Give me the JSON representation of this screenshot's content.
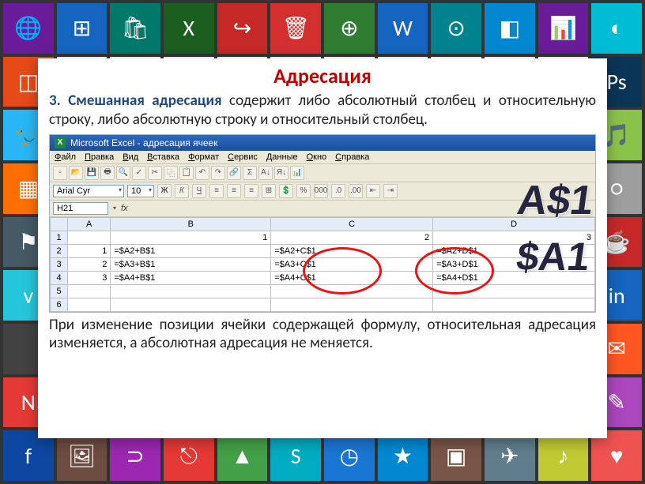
{
  "slide": {
    "title": "Адресация",
    "intro_num": "3.",
    "intro_bold": "Смешанная адресация",
    "intro_rest": " содержит либо абсолютный столбец и относительную строку, либо абсолютную строку и относительный столбец.",
    "outro": "При изменение позиции ячейки содержащей формулу, относительная адресация изменяется, а абсолютная адресация не меняется.",
    "ref1": "A$1",
    "ref2": "$A1"
  },
  "excel": {
    "title": "Microsoft Excel - адресация ячеек",
    "menu": [
      "Файл",
      "Правка",
      "Вид",
      "Вставка",
      "Формат",
      "Сервис",
      "Данные",
      "Окно",
      "Справка"
    ],
    "font": "Arial Cyr",
    "size": "10",
    "fmtbtns": [
      "Ж",
      "К",
      "Ч"
    ],
    "namebox": "H21",
    "fx": "fx",
    "cols": [
      "A",
      "B",
      "C",
      "D"
    ],
    "rows": [
      {
        "n": "1",
        "A": "",
        "B": "1",
        "C": "2",
        "D": "3"
      },
      {
        "n": "2",
        "A": "1",
        "B": "=$A2+B$1",
        "C": "=$A2+C$1",
        "D": "=$A2+D$1"
      },
      {
        "n": "3",
        "A": "2",
        "B": "=$A3+B$1",
        "C": "=$A3+C$1",
        "D": "=$A3+D$1"
      },
      {
        "n": "4",
        "A": "3",
        "B": "=$A4+B$1",
        "C": "=$A4+C$1",
        "D": "=$A4+D$1"
      },
      {
        "n": "5",
        "A": "",
        "B": "",
        "C": "",
        "D": ""
      },
      {
        "n": "6",
        "A": "",
        "B": "",
        "C": "",
        "D": ""
      }
    ]
  },
  "tiles": [
    {
      "c": "#6a1b9a",
      "g": "🌐"
    },
    {
      "c": "#1565c0",
      "g": "⊞"
    },
    {
      "c": "#00796b",
      "g": "🛍"
    },
    {
      "c": "#1b5e20",
      "g": "X"
    },
    {
      "c": "#c62828",
      "g": "↪"
    },
    {
      "c": "#d32f2f",
      "g": "🗑"
    },
    {
      "c": "#2e7d32",
      "g": "⊕"
    },
    {
      "c": "#1565c0",
      "g": "W"
    },
    {
      "c": "#00838f",
      "g": "⊙"
    },
    {
      "c": "#0288d1",
      "g": "◧"
    },
    {
      "c": "#6a1b9a",
      "g": "📊"
    },
    {
      "c": "#00bcd4",
      "g": "◐"
    },
    {
      "c": "#e64a19",
      "g": "◫"
    },
    {
      "c": "#fff",
      "g": ""
    },
    {
      "c": "#fff",
      "g": ""
    },
    {
      "c": "#fff",
      "g": ""
    },
    {
      "c": "#fff",
      "g": ""
    },
    {
      "c": "#fff",
      "g": ""
    },
    {
      "c": "#fff",
      "g": ""
    },
    {
      "c": "#fff",
      "g": ""
    },
    {
      "c": "#fff",
      "g": ""
    },
    {
      "c": "#fff",
      "g": ""
    },
    {
      "c": "#fff",
      "g": ""
    },
    {
      "c": "#0b3556",
      "g": "Ps"
    },
    {
      "c": "#29b6f6",
      "g": "🐦"
    },
    {
      "c": "#fff",
      "g": ""
    },
    {
      "c": "#fff",
      "g": ""
    },
    {
      "c": "#fff",
      "g": ""
    },
    {
      "c": "#fff",
      "g": ""
    },
    {
      "c": "#fff",
      "g": ""
    },
    {
      "c": "#fff",
      "g": ""
    },
    {
      "c": "#fff",
      "g": ""
    },
    {
      "c": "#fff",
      "g": ""
    },
    {
      "c": "#fff",
      "g": ""
    },
    {
      "c": "#fff",
      "g": ""
    },
    {
      "c": "#8bc34a",
      "g": "🎵"
    },
    {
      "c": "#ff6f00",
      "g": "▦"
    },
    {
      "c": "#fff",
      "g": ""
    },
    {
      "c": "#fff",
      "g": ""
    },
    {
      "c": "#fff",
      "g": ""
    },
    {
      "c": "#fff",
      "g": ""
    },
    {
      "c": "#fff",
      "g": ""
    },
    {
      "c": "#fff",
      "g": ""
    },
    {
      "c": "#fff",
      "g": ""
    },
    {
      "c": "#fff",
      "g": ""
    },
    {
      "c": "#fff",
      "g": ""
    },
    {
      "c": "#fff",
      "g": ""
    },
    {
      "c": "#9e9e9e",
      "g": "○"
    },
    {
      "c": "#455a64",
      "g": "⚑"
    },
    {
      "c": "#fff",
      "g": ""
    },
    {
      "c": "#fff",
      "g": ""
    },
    {
      "c": "#fff",
      "g": ""
    },
    {
      "c": "#fff",
      "g": ""
    },
    {
      "c": "#fff",
      "g": ""
    },
    {
      "c": "#fff",
      "g": ""
    },
    {
      "c": "#fff",
      "g": ""
    },
    {
      "c": "#fff",
      "g": ""
    },
    {
      "c": "#fff",
      "g": ""
    },
    {
      "c": "#fff",
      "g": ""
    },
    {
      "c": "#c62828",
      "g": "☕"
    },
    {
      "c": "#26c6da",
      "g": "v"
    },
    {
      "c": "#fff",
      "g": ""
    },
    {
      "c": "#fff",
      "g": ""
    },
    {
      "c": "#fff",
      "g": ""
    },
    {
      "c": "#fff",
      "g": ""
    },
    {
      "c": "#fff",
      "g": ""
    },
    {
      "c": "#fff",
      "g": ""
    },
    {
      "c": "#fff",
      "g": ""
    },
    {
      "c": "#fff",
      "g": ""
    },
    {
      "c": "#fff",
      "g": ""
    },
    {
      "c": "#fff",
      "g": ""
    },
    {
      "c": "#1565c0",
      "g": "in"
    },
    {
      "c": "#424242",
      "g": ""
    },
    {
      "c": "#fff",
      "g": ""
    },
    {
      "c": "#fff",
      "g": ""
    },
    {
      "c": "#fff",
      "g": ""
    },
    {
      "c": "#fff",
      "g": ""
    },
    {
      "c": "#fff",
      "g": ""
    },
    {
      "c": "#fff",
      "g": ""
    },
    {
      "c": "#fff",
      "g": ""
    },
    {
      "c": "#fff",
      "g": ""
    },
    {
      "c": "#fff",
      "g": ""
    },
    {
      "c": "#fff",
      "g": ""
    },
    {
      "c": "#ff5722",
      "g": "✉"
    },
    {
      "c": "#e53935",
      "g": "N"
    },
    {
      "c": "#fff",
      "g": ""
    },
    {
      "c": "#fff",
      "g": ""
    },
    {
      "c": "#fff",
      "g": ""
    },
    {
      "c": "#fff",
      "g": ""
    },
    {
      "c": "#fff",
      "g": ""
    },
    {
      "c": "#fff",
      "g": ""
    },
    {
      "c": "#fff",
      "g": ""
    },
    {
      "c": "#fff",
      "g": ""
    },
    {
      "c": "#fff",
      "g": ""
    },
    {
      "c": "#fff",
      "g": ""
    },
    {
      "c": "#ab47bc",
      "g": "✎"
    },
    {
      "c": "#0d47a1",
      "g": "f"
    },
    {
      "c": "#6d4c41",
      "g": "🖼"
    },
    {
      "c": "#9c27b0",
      "g": "⊃"
    },
    {
      "c": "#e53935",
      "g": "⎋"
    },
    {
      "c": "#43a047",
      "g": "▲"
    },
    {
      "c": "#00acc1",
      "g": "S"
    },
    {
      "c": "#1976d2",
      "g": "◷"
    },
    {
      "c": "#0288d1",
      "g": "★"
    },
    {
      "c": "#795548",
      "g": "▣"
    },
    {
      "c": "#607d8b",
      "g": "✈"
    },
    {
      "c": "#c0ca33",
      "g": "♪"
    },
    {
      "c": "#ef5350",
      "g": "♥"
    }
  ]
}
